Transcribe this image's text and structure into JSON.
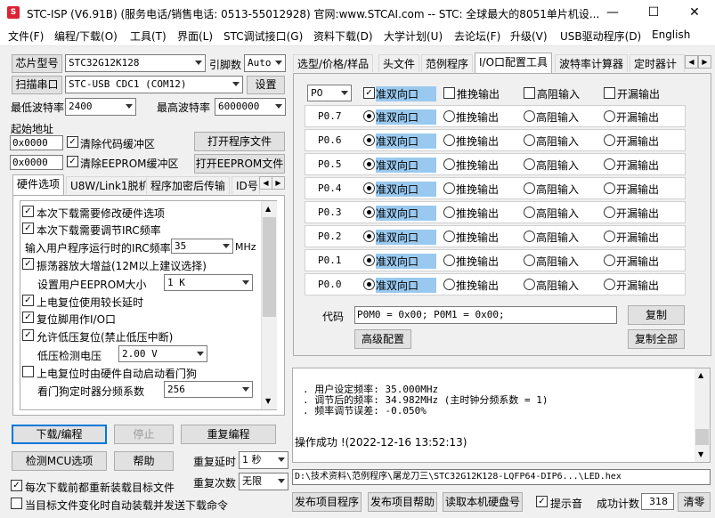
{
  "titlebar": {
    "app_icon": "stc-logo-icon",
    "title": "STC-ISP (V6.91B) (服务电话/销售电话: 0513-55012928) 官网:www.STCAI.com  -- STC: 全球最大的8051单片机设...",
    "minimize": "—",
    "maximize": "☐",
    "close": "✕"
  },
  "menu": [
    "文件(F)",
    "编程/下载(O)",
    "工具(T)",
    "界面(L)",
    "STC调试接口(G)",
    "资料下载(D)",
    "大学计划(U)",
    "去论坛(F)",
    "升级(V)",
    "USB驱动程序(D)",
    "English"
  ],
  "left": {
    "chip_button": "芯片型号",
    "chip_value": "STC32G12K128",
    "pin_label": "引脚数",
    "pin_value": "Auto",
    "scan_button": "扫描串口",
    "port_value": "STC-USB CDC1 (COM12)",
    "settings_button": "设置",
    "min_baud_label": "最低波特率",
    "min_baud_value": "2400",
    "max_baud_label": "最高波特率",
    "max_baud_value": "6000000",
    "start_addr_label": "起始地址",
    "code_addr": "0x0000",
    "clear_code_label": "清除代码缓冲区",
    "open_prog_button": "打开程序文件",
    "eeprom_addr": "0x0000",
    "clear_eeprom_label": "清除EEPROM缓冲区",
    "open_eeprom_button": "打开EEPROM文件",
    "tabs": [
      "硬件选项",
      "U8W/Link1脱机",
      "程序加密后传输",
      "ID号"
    ],
    "hw": {
      "opt1": "本次下载需要修改硬件选项",
      "opt2": "本次下载需要调节IRC频率",
      "irc_label": "输入用户程序运行时的IRC频率",
      "irc_value": "35",
      "irc_unit": "MHz",
      "opt3": "振荡器放大增益(12M以上建议选择)",
      "eeprom_size_label": "设置用户EEPROM大小",
      "eeprom_size_value": "1    K",
      "opt4": "上电复位使用较长延时",
      "opt5": "复位脚用作I/O口",
      "opt6": "允许低压复位(禁止低压中断)",
      "lvd_label": "低压检测电压",
      "lvd_value": "2.00 V",
      "opt7": "上电复位时由硬件自动启动看门狗",
      "wdt_label": "看门狗定时器分频系数",
      "wdt_value": "256"
    },
    "download_button": "下载/编程",
    "stop_button": "停止",
    "reprogram_button": "重复编程",
    "check_mcu_button": "检测MCU选项",
    "help_button": "帮助",
    "repeat_delay_label": "重复延时",
    "repeat_delay_value": "1 秒",
    "repeat_count_label": "重复次数",
    "repeat_count_value": "无限",
    "reload_label": "每次下载前都重新装载目标文件",
    "auto_load_label": "当目标文件变化时自动装载并发送下载命令"
  },
  "right": {
    "tabs": [
      "选型/价格/样品",
      "头文件",
      "范例程序",
      "I/O口配置工具",
      "波特率计算器",
      "定时器计"
    ],
    "port_select": "P0",
    "header_modes": [
      "准双向口",
      "推挽输出",
      "高阻输入",
      "开漏输出"
    ],
    "modes": [
      "准双向口",
      "推挽输出",
      "高阻输入",
      "开漏输出"
    ],
    "pins": [
      "P0.7",
      "P0.6",
      "P0.5",
      "P0.4",
      "P0.3",
      "P0.2",
      "P0.1",
      "P0.0"
    ],
    "code_label": "代码",
    "code_value": "P0M0 = 0x00;   P0M1 = 0x00;",
    "copy_button": "复制",
    "advanced_button": "高级配置",
    "copy_all_button": "复制全部"
  },
  "log": {
    "lines": [
      ". 用户设定频率: 35.000MHz",
      ". 调节后的频率: 34.982MHz (主时钟分频系数 = 1)",
      ". 频率调节误差: -0.050%"
    ],
    "result": "操作成功 !(2022-12-16 13:52:13)"
  },
  "file_path": "D:\\技术资料\\范例程序\\屠龙刀三\\STC32G12K128-LQFP64-DIP6...\\LED.hex",
  "bottom": {
    "publish_prog_button": "发布项目程序",
    "publish_help_button": "发布项目帮助",
    "read_disk_button": "读取本机硬盘号",
    "sound_label": "提示音",
    "success_label": "成功计数",
    "success_count": "318",
    "clear_button": "清零"
  }
}
